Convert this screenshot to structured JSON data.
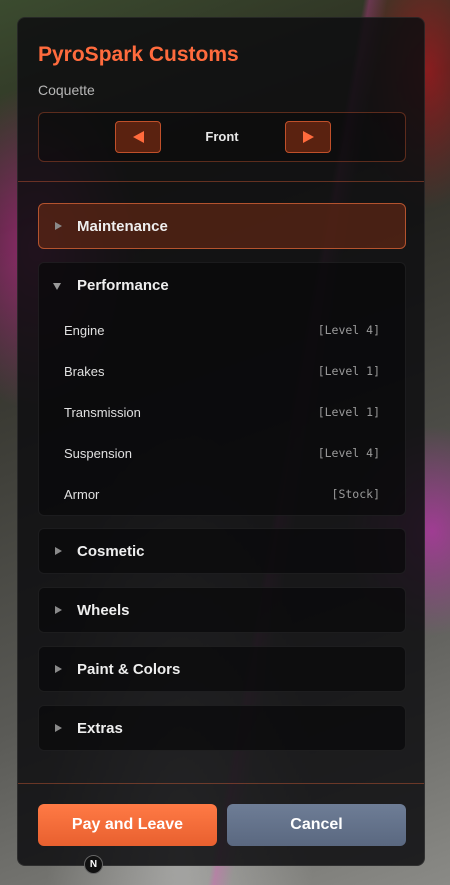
{
  "shop": {
    "title": "PyroSpark Customs",
    "vehicle": "Coquette"
  },
  "camera": {
    "label": "Front",
    "prev_icon": "arrow-left-icon",
    "next_icon": "arrow-right-icon"
  },
  "sections": [
    {
      "label": "Maintenance",
      "expanded": false,
      "highlighted": true
    },
    {
      "label": "Performance",
      "expanded": true,
      "highlighted": false,
      "items": [
        {
          "label": "Engine",
          "value": "[Level 4]"
        },
        {
          "label": "Brakes",
          "value": "[Level 1]"
        },
        {
          "label": "Transmission",
          "value": "[Level 1]"
        },
        {
          "label": "Suspension",
          "value": "[Level 4]"
        },
        {
          "label": "Armor",
          "value": "[Stock]"
        }
      ]
    },
    {
      "label": "Cosmetic",
      "expanded": false,
      "highlighted": false
    },
    {
      "label": "Wheels",
      "expanded": false,
      "highlighted": false
    },
    {
      "label": "Paint & Colors",
      "expanded": false,
      "highlighted": false
    },
    {
      "label": "Extras",
      "expanded": false,
      "highlighted": false
    }
  ],
  "actions": {
    "pay_label": "Pay and Leave",
    "cancel_label": "Cancel"
  },
  "badge": {
    "label": "N"
  },
  "colors": {
    "accent": "#ff6b3d",
    "pay_button": "#f06a35",
    "cancel_button": "#65738b",
    "panel_bg": "#0e0e10"
  }
}
